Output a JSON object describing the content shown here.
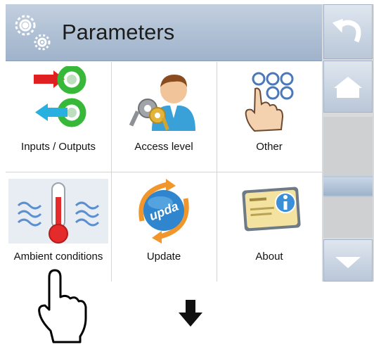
{
  "header": {
    "title": "Parameters",
    "icon": "gears-icon"
  },
  "tiles": [
    {
      "label": "Inputs / Outputs",
      "icon": "inputs-outputs-icon"
    },
    {
      "label": "Access level",
      "icon": "user-keys-icon"
    },
    {
      "label": "Other",
      "icon": "touch-dots-icon"
    },
    {
      "label": "Ambient conditions",
      "icon": "thermometer-icon"
    },
    {
      "label": "Update",
      "icon": "update-icon"
    },
    {
      "label": "About",
      "icon": "info-card-icon"
    }
  ],
  "sidebar": {
    "back": "undo-arrow-icon",
    "home": "home-icon",
    "scroll_down": "down-arrow-icon"
  },
  "update_globe_text": "upda",
  "annotation": {
    "pointer": "hand-pointer-icon",
    "arrow": "down-arrow-icon"
  },
  "colors": {
    "header": "#b0c1d6",
    "arrow_red": "#e02020",
    "arrow_blue": "#28b0e0",
    "ring_green": "#38b838"
  }
}
